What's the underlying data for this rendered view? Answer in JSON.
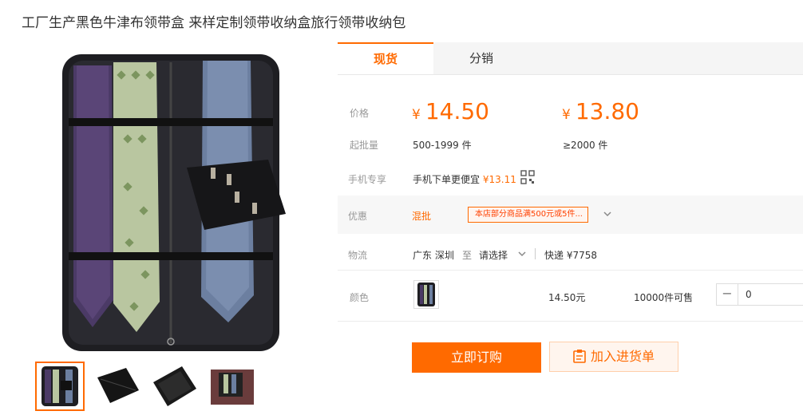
{
  "product": {
    "title": "工厂生产黑色牛津布领带盒 来样定制领带收纳盒旅行领带收纳包"
  },
  "tabs": [
    {
      "label": "现货"
    },
    {
      "label": "分销"
    }
  ],
  "price": {
    "label": "价格",
    "currency": "¥",
    "tiers": [
      {
        "price": "14.50",
        "qty": "500-1999 件"
      },
      {
        "price": "13.80",
        "qty": "≥2000 件"
      }
    ],
    "moq_label": "起批量"
  },
  "mobile": {
    "label": "手机专享",
    "text": "手机下单更便宜",
    "price": "¥13.11"
  },
  "promo": {
    "label": "优惠",
    "name": "混批",
    "coupon": "本店部分商品满500元或5件..."
  },
  "logistics": {
    "label": "物流",
    "from": "广东 深圳",
    "to_word": "至",
    "select": "请选择",
    "shipping": "快递 ¥7758"
  },
  "color": {
    "label": "颜色",
    "price": "14.50元",
    "stock": "10000件可售",
    "qty": "0"
  },
  "actions": {
    "buy": "立即订购",
    "cart": "加入进货单"
  },
  "accent": "#ff6a00"
}
